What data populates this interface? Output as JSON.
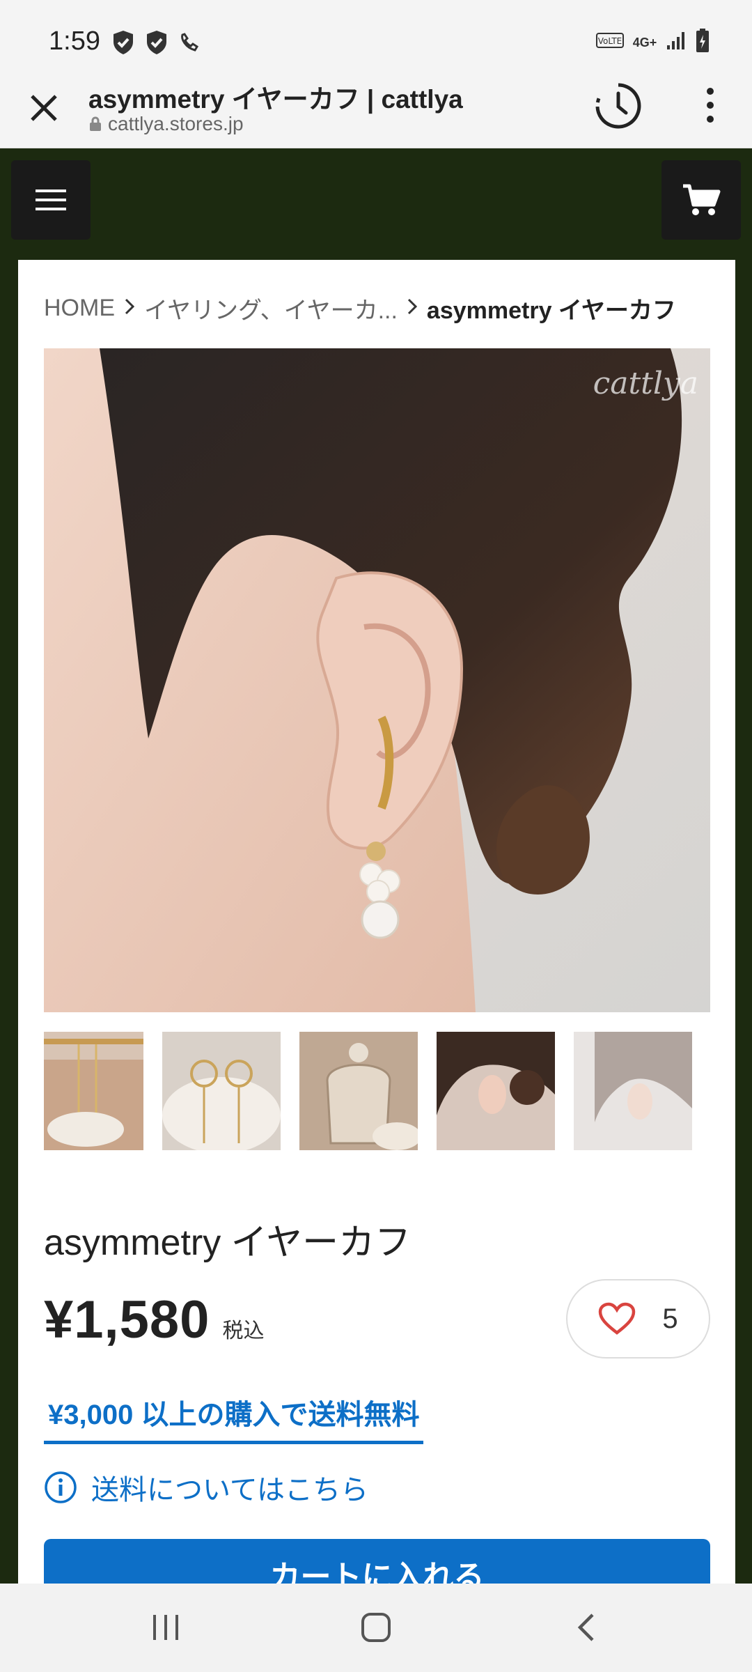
{
  "status_bar": {
    "time": "1:59",
    "icons_left": [
      "shield-icon",
      "shield-icon",
      "call-icon"
    ],
    "icons_right": [
      "volte-icon",
      "4g-icon",
      "signal-icon",
      "battery-icon"
    ],
    "network": "4G+"
  },
  "tab_bar": {
    "title": "asymmetry イヤーカフ | cattlya",
    "url": "cattlya.stores.jp"
  },
  "breadcrumb": {
    "home": "HOME",
    "category": "イヤリング、イヤーカ...",
    "current": "asymmetry イヤーカフ"
  },
  "product": {
    "image_watermark": "cattlya",
    "title": "asymmetry イヤーカフ",
    "price": "¥1,580",
    "tax_label": "税込",
    "like_count": "5",
    "free_shipping": "¥3,000 以上の購入で送料無料",
    "shipping_info": "送料についてはこちら",
    "cart_button": "カートに入れる"
  },
  "colors": {
    "header_bg": "#1c2a10",
    "accent": "#0d6fc7",
    "heart": "#d9443f"
  }
}
